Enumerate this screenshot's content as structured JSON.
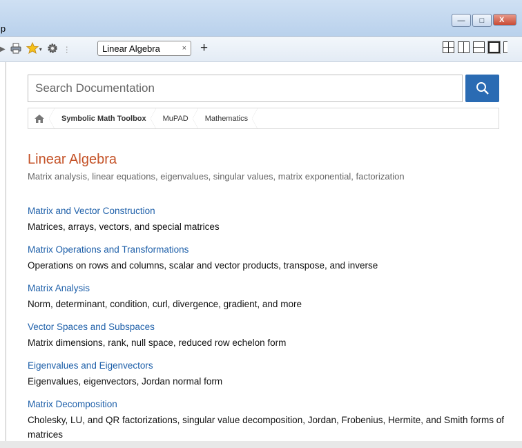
{
  "window": {
    "title_fragment": "lp",
    "min_label": "—",
    "max_label": "□",
    "close_label": "X"
  },
  "toolbar": {
    "tab_label": "Linear Algebra",
    "tab_close": "×",
    "new_tab": "+"
  },
  "search": {
    "placeholder": "Search Documentation"
  },
  "breadcrumb": [
    "Symbolic Math Toolbox",
    "MuPAD",
    "Mathematics"
  ],
  "page": {
    "title": "Linear Algebra",
    "subtitle": "Matrix analysis, linear equations, eigenvalues, singular values, matrix exponential, factorization"
  },
  "sections": [
    {
      "link": "Matrix and Vector Construction",
      "desc": "Matrices, arrays, vectors, and special matrices"
    },
    {
      "link": "Matrix Operations and Transformations",
      "desc": "Operations on rows and columns, scalar and vector products, transpose, and inverse"
    },
    {
      "link": "Matrix Analysis",
      "desc": "Norm, determinant, condition, curl, divergence, gradient, and more"
    },
    {
      "link": "Vector Spaces and Subspaces",
      "desc": "Matrix dimensions, rank, null space, reduced row echelon form"
    },
    {
      "link": "Eigenvalues and Eigenvectors",
      "desc": "Eigenvalues, eigenvectors, Jordan normal form"
    },
    {
      "link": "Matrix Decomposition",
      "desc": "Cholesky, LU, and QR factorizations, singular value decomposition, Jordan, Frobenius, Hermite, and Smith forms of matrices"
    }
  ],
  "colors": {
    "title": "#c45126",
    "link": "#1d5fa9",
    "search_button": "#2a6bb3"
  }
}
